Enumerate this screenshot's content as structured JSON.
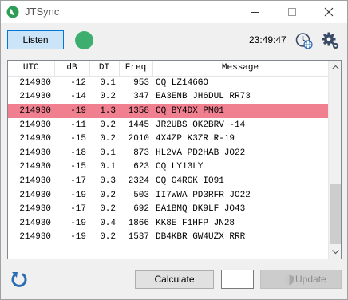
{
  "window": {
    "title": "JTSync"
  },
  "toolbar": {
    "listen_label": "Listen",
    "clock": "23:49:47",
    "status_color": "#3dae6e"
  },
  "table": {
    "columns": [
      "UTC",
      "dB",
      "DT",
      "Freq",
      "Message"
    ],
    "highlight_color": "#f08090",
    "rows": [
      {
        "utc": "214930",
        "db": "-12",
        "dt": "0.1",
        "freq": "953",
        "message": "CQ LZ146GO",
        "highlighted": false
      },
      {
        "utc": "214930",
        "db": "-14",
        "dt": "0.2",
        "freq": "347",
        "message": "EA3ENB JH6DUL RR73",
        "highlighted": false
      },
      {
        "utc": "214930",
        "db": "-19",
        "dt": "1.3",
        "freq": "1358",
        "message": "CQ BY4DX PM01",
        "highlighted": true
      },
      {
        "utc": "214930",
        "db": "-11",
        "dt": "0.2",
        "freq": "1445",
        "message": "JR2UBS OK2BRV -14",
        "highlighted": false
      },
      {
        "utc": "214930",
        "db": "-15",
        "dt": "0.2",
        "freq": "2010",
        "message": "4X4ZP K3ZR R-19",
        "highlighted": false
      },
      {
        "utc": "214930",
        "db": "-18",
        "dt": "0.1",
        "freq": "873",
        "message": "HL2VA PD2HAB JO22",
        "highlighted": false
      },
      {
        "utc": "214930",
        "db": "-15",
        "dt": "0.1",
        "freq": "623",
        "message": "CQ LY13LY",
        "highlighted": false
      },
      {
        "utc": "214930",
        "db": "-17",
        "dt": "0.3",
        "freq": "2324",
        "message": "CQ G4RGK IO91",
        "highlighted": false
      },
      {
        "utc": "214930",
        "db": "-19",
        "dt": "0.2",
        "freq": "503",
        "message": "II7WWA PD3RFR JO22",
        "highlighted": false
      },
      {
        "utc": "214930",
        "db": "-17",
        "dt": "0.2",
        "freq": "692",
        "message": "EA1BMQ DK9LF JO43",
        "highlighted": false
      },
      {
        "utc": "214930",
        "db": "-19",
        "dt": "0.4",
        "freq": "1866",
        "message": "KK8E F1HFP JN28",
        "highlighted": false
      },
      {
        "utc": "214930",
        "db": "-19",
        "dt": "0.2",
        "freq": "1537",
        "message": "DB4KBR GW4UZX RRR",
        "highlighted": false
      }
    ]
  },
  "bottom": {
    "calculate_label": "Calculate",
    "result_value": "",
    "update_label": "Update"
  },
  "icons": {
    "app": "app-icon",
    "globe": "globe-clock-icon",
    "gear": "gear-icon",
    "refresh": "refresh-icon",
    "shield": "shield-icon"
  }
}
